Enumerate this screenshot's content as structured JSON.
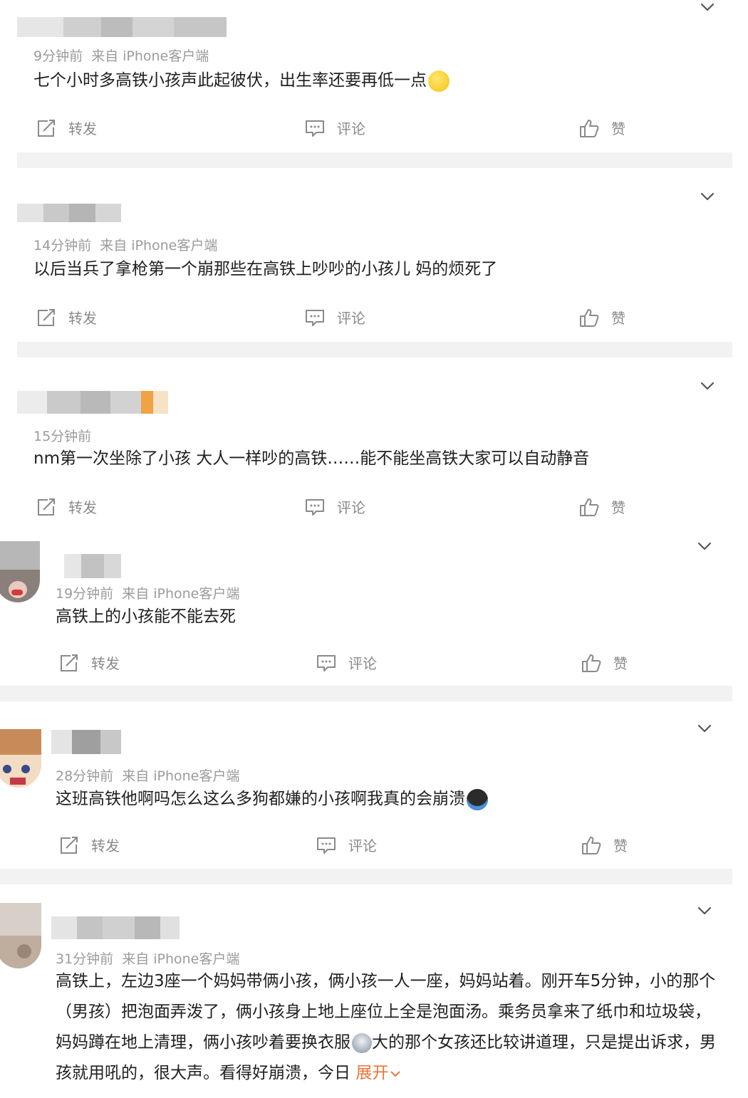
{
  "posts": [
    {
      "time": "9分钟前",
      "source": "来自 iPhone客户端",
      "text": "七个小时多高铁小孩声此起彼伏，出生率还要再低一点",
      "emoji": "smile-emoji",
      "actions": {
        "repost": "转发",
        "comment": "评论",
        "like": "赞"
      }
    },
    {
      "time": "14分钟前",
      "source": "来自 iPhone客户端",
      "text": "以后当兵了拿枪第一个崩那些在高铁上吵吵的小孩儿 妈的烦死了",
      "actions": {
        "repost": "转发",
        "comment": "评论",
        "like": "赞"
      }
    },
    {
      "time": "15分钟前",
      "source": "",
      "text": "nm第一次坐除了小孩 大人一样吵的高铁……能不能坐高铁大家可以自动静音",
      "actions": {
        "repost": "转发",
        "comment": "评论",
        "like": "赞"
      }
    },
    {
      "time": "19分钟前",
      "source": "来自 iPhone客户端",
      "text": "高铁上的小孩能不能去死",
      "actions": {
        "repost": "转发",
        "comment": "评论",
        "like": "赞"
      }
    },
    {
      "time": "28分钟前",
      "source": "来自 iPhone客户端",
      "text": "这班高铁他啊吗怎么这么多狗都嫌的小孩啊我真的会崩溃",
      "emoji": "crying-emoji",
      "actions": {
        "repost": "转发",
        "comment": "评论",
        "like": "赞"
      }
    },
    {
      "time": "31分钟前",
      "source": "来自 iPhone客户端",
      "text_a": "高铁上，左边3座一个妈妈带俩小孩，俩小孩一人一座，妈妈站着。刚开车5分钟，小的那个（男孩）把泡面弄泼了，俩小孩身上地上座位上全是泡面汤。乘务员拿来了纸巾和垃圾袋，妈妈蹲在地上清理，俩小孩吵着要换衣服",
      "text_b": "大的那个女孩还比较讲道理，只是提出诉求，男孩就用吼的，很大声。看得好崩溃，今日",
      "emoji": "sad-emoji",
      "expand": "展开"
    }
  ],
  "colors": {
    "accent": "#e8763a",
    "meta": "#9b9b9b",
    "divider": "#f2f2f2"
  }
}
